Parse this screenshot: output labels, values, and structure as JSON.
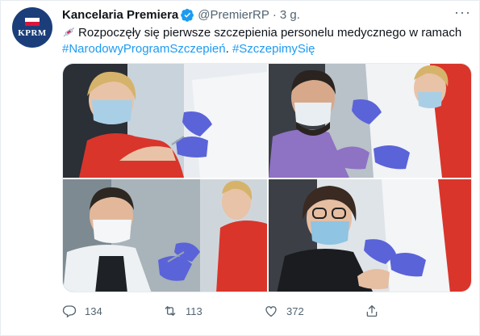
{
  "tweet": {
    "author_name": "Kancelaria Premiera",
    "avatar_text": "KPRM",
    "handle": "@PremierRP",
    "separator": "·",
    "time": "3 g.",
    "more": "···",
    "text_main": "Rozpoczęły się pierwsze szczepienia personelu medycznego w ramach",
    "hashtag1": "#NarodowyProgramSzczepień",
    "text_sep": ".",
    "hashtag2": "#SzczepimySię",
    "media": [
      {
        "desc": "nurse-in-red-scrubs-vaccinated"
      },
      {
        "desc": "bearded-man-purple-scrubs-vaccinated"
      },
      {
        "desc": "man-white-coat-vaccinated"
      },
      {
        "desc": "woman-glasses-vaccinated"
      }
    ],
    "actions": {
      "replies": "134",
      "retweets": "113",
      "likes": "372"
    },
    "colors": {
      "link": "#1d9bf0",
      "verified": "#1d9bf0",
      "avatar_bg": "#1b3e7a",
      "secondary_text": "#536471"
    },
    "icons": {
      "verified": "verified-badge-icon",
      "reply": "reply-icon",
      "retweet": "retweet-icon",
      "like": "heart-icon",
      "share": "share-icon",
      "more": "more-icon",
      "emoji": "syringe-emoji-icon"
    }
  }
}
